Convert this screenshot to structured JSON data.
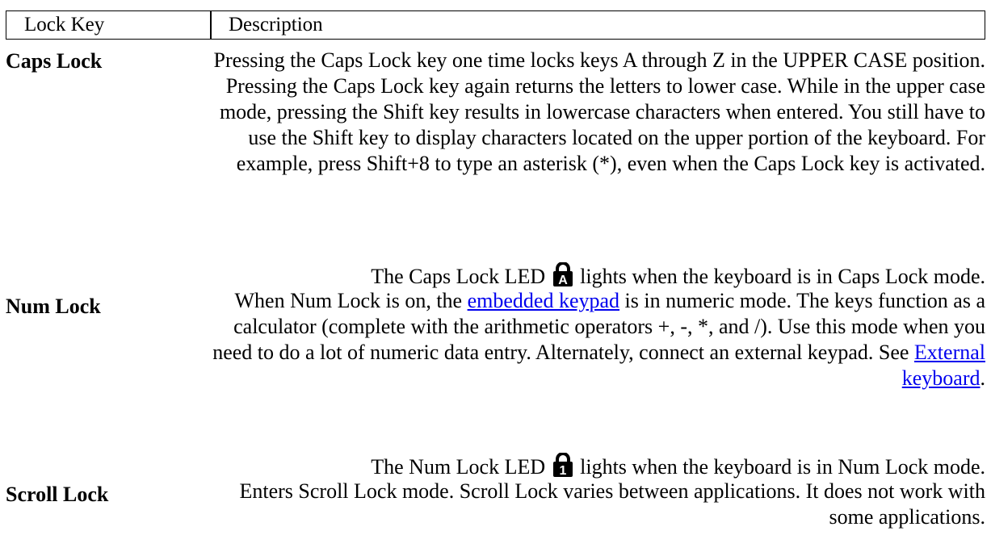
{
  "table": {
    "headers": {
      "key": "Lock Key",
      "description": "Description"
    },
    "rows": [
      {
        "key": "Caps Lock",
        "description": "Pressing the Caps Lock key one time locks keys A through Z in the UPPER CASE position. Pressing the Caps Lock key again returns the letters to lower case. While in the upper case mode, pressing the Shift key results in lowercase characters when entered. You still have to use the Shift key to display characters located on the upper portion of the keyboard. For example, press Shift+8 to type an asterisk (*), even when the Caps Lock key is activated.",
        "led_before": "The Caps Lock LED",
        "led_icon": "caps-lock-led-icon",
        "led_icon_letter": "A",
        "led_after": "lights when the keyboard is in Caps Lock mode."
      },
      {
        "key": "Num Lock",
        "desc_part1": "When Num Lock is on, the",
        "link1": "embedded keypad",
        "desc_part2": "is in numeric mode. The keys function as a calculator (complete with the arithmetic operators +, -, *, and /). Use this mode when you need to do a lot of numeric data entry. Alternately, connect an external keypad. See",
        "link2": "External keyboard",
        "desc_part3": ".",
        "led_before": "The Num Lock LED",
        "led_icon": "num-lock-led-icon",
        "led_icon_letter": "1",
        "led_after": "lights when the keyboard is in Num Lock mode."
      },
      {
        "key": "Scroll Lock",
        "description": "Enters Scroll Lock mode. Scroll Lock varies between applications. It does not work with some applications."
      }
    ]
  }
}
